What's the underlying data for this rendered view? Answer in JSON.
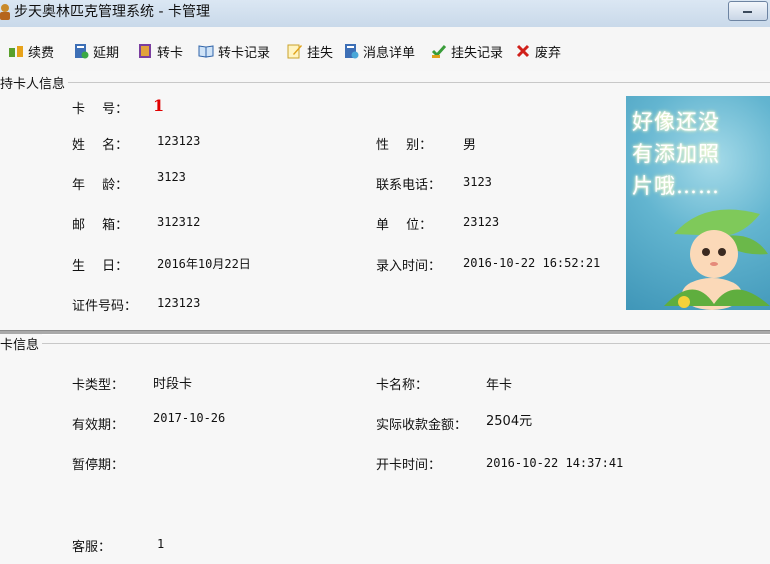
{
  "window": {
    "title": "步天奥林匹克管理系统 - 卡管理"
  },
  "toolbar": {
    "items": [
      {
        "label": "续费",
        "icon": "renew-icon"
      },
      {
        "label": "延期",
        "icon": "extend-icon"
      },
      {
        "label": "转卡",
        "icon": "transfer-icon"
      },
      {
        "label": "转卡记录",
        "icon": "book-icon"
      },
      {
        "label": "挂失",
        "icon": "pencil-icon"
      },
      {
        "label": "消息详单",
        "icon": "message-icon"
      },
      {
        "label": "挂失记录",
        "icon": "loss-record-icon"
      },
      {
        "label": "废弃",
        "icon": "red-x-icon"
      }
    ]
  },
  "holder": {
    "section_title": "持卡人信息",
    "card_no_label": "卡　 号：",
    "card_no": "1",
    "name_label": "姓　 名：",
    "name": "123123",
    "gender_label": "性　 别：",
    "gender": "男",
    "age_label": "年　 龄：",
    "age": "3123",
    "phone_label": "联系电话：",
    "phone": "3123",
    "email_label": "邮　 箱：",
    "email": "312312",
    "unit_label": "单　 位：",
    "unit": "23123",
    "birthday_label": "生　 日：",
    "birthday": "2016年10月22日",
    "entry_time_label": "录入时间：",
    "entry_time": "2016-10-22 16:52:21",
    "id_label": "证件号码：",
    "id_number": "123123",
    "photo_text": [
      "好像还没",
      "有添加照",
      "片哦……"
    ]
  },
  "card": {
    "section_title": "卡信息",
    "type_label": "卡类型：",
    "type": "时段卡",
    "name_label": "卡名称：",
    "name": "年卡",
    "valid_label": "有效期：",
    "valid": "2017-10-26",
    "amount_label": "实际收款金额：",
    "amount": "2504元",
    "pause_label": "暂停期：",
    "open_time_label": "开卡时间：",
    "open_time": "2016-10-22 14:37:41",
    "service_label": "客服：",
    "service": "1"
  }
}
